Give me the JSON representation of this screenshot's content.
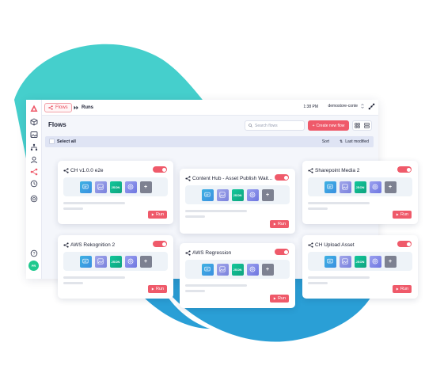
{
  "colors": {
    "accent": "#ef5a6a",
    "teal_blob": "#45cfcc",
    "blue_blob": "#2a9fd6"
  },
  "topbar": {
    "tabs": [
      {
        "label": "Flows",
        "icon": "flow-icon",
        "active": true
      },
      {
        "label": "Runs",
        "icon": "play-double-icon",
        "active": false
      }
    ],
    "time": "1:38 PM",
    "domain": "demostore-conte"
  },
  "sidebar": {
    "icons": [
      "logo-icon",
      "cube-icon",
      "image-icon",
      "hierarchy-icon",
      "user-icon",
      "flow-icon",
      "clock-icon",
      "at-icon",
      "help-icon",
      "avatar"
    ],
    "avatar_initials": "PR"
  },
  "main": {
    "title": "Flows",
    "search_placeholder": "Search flows",
    "create_label": "Create new flow",
    "select_all": "Select all",
    "sort_label": "Sort",
    "sort_value": "Last modified"
  },
  "step_labels": {
    "json": "JSON",
    "add": "+"
  },
  "run_label": "Run",
  "cards": [
    {
      "title": "CH v1.0.0 e2e"
    },
    {
      "title": "Content Hub - Asset Publish Wait..."
    },
    {
      "title": "Sharepoint Media 2"
    },
    {
      "title": "AWS Rekognition 2"
    },
    {
      "title": "AWS Regression"
    },
    {
      "title": "CH Upload Asset"
    }
  ]
}
